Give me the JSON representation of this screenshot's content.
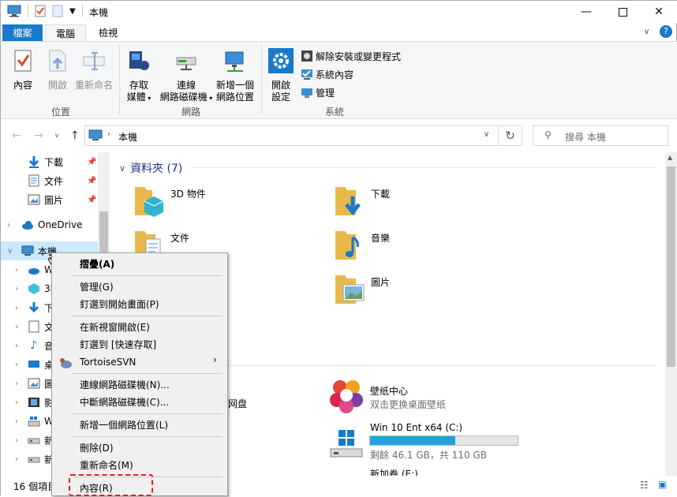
{
  "window": {
    "title": "本機"
  },
  "ribbon_tabs": {
    "file": "檔案",
    "computer": "電腦",
    "view": "檢視"
  },
  "ribbon": {
    "location": {
      "label": "位置",
      "properties": "內容",
      "open": "開啟",
      "rename": "重新命名"
    },
    "network": {
      "label": "網路",
      "access_media": [
        "存取",
        "媒體"
      ],
      "map_drive": [
        "連線",
        "網路磁碟機"
      ],
      "add_location": [
        "新增一個",
        "網路位置"
      ]
    },
    "system": {
      "label": "系統",
      "open_settings": [
        "開啟",
        "設定"
      ],
      "uninstall": "解除安裝或變更程式",
      "system_properties": "系統內容",
      "manage": "管理"
    }
  },
  "address": {
    "path": "本機",
    "search_placeholder": "搜尋 本機"
  },
  "nav_pane": {
    "quick": [
      "下載",
      "文件",
      "圖片"
    ],
    "onedrive": "OneDrive",
    "this_pc": "本機",
    "children_visible": [
      "W",
      "3I",
      "下",
      "文",
      "音",
      "桌",
      "圖",
      "影",
      "W",
      "新",
      "新"
    ]
  },
  "content": {
    "folders_header": "資料夾 (7)",
    "folders": [
      {
        "name": "3D 物件"
      },
      {
        "name": "下載"
      },
      {
        "name": "文件"
      },
      {
        "name": "音樂"
      },
      {
        "name": ""
      },
      {
        "name": "圖片"
      }
    ],
    "device_partial_text": "网盘",
    "wallpaper": {
      "name": "壁纸中心",
      "desc": "双击更换桌面壁纸"
    },
    "drive_c": {
      "name": "Win 10 Ent x64 (C:)",
      "free": "剩餘 46.1 GB，共 110 GB",
      "used_fraction": 0.58
    },
    "drive_e": {
      "name": "新加卷 (E:)"
    }
  },
  "status": {
    "items": "16 個項目"
  },
  "context_menu": {
    "collapse": "摺疊(A)",
    "manage": "管理(G)",
    "pin_start": "釘選到開始畫面(P)",
    "open_new_window": "在新視窗開啟(E)",
    "pin_quick": "釘選到 [快速存取]",
    "tortoise": "TortoiseSVN",
    "map_drive": "連線網路磁碟機(N)...",
    "disconnect_drive": "中斷網路磁碟機(C)...",
    "add_location": "新增一個網路位置(L)",
    "delete": "刪除(D)",
    "rename": "重新命名(M)",
    "properties": "內容(R)"
  }
}
